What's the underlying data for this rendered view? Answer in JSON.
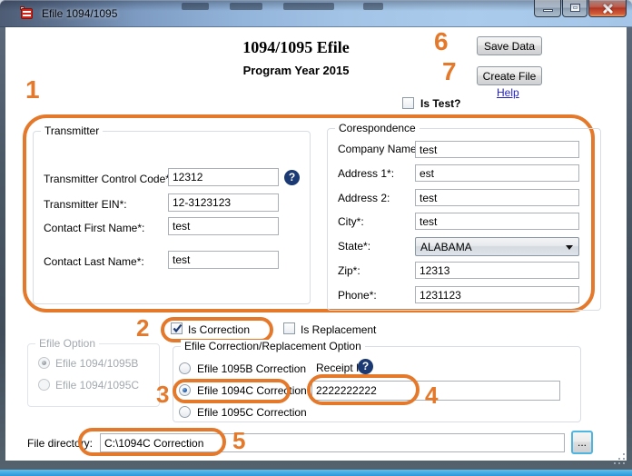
{
  "window": {
    "title": "Efile 1094/1095"
  },
  "header": {
    "title": "1094/1095 Efile",
    "subtitle": "Program Year 2015",
    "save_button": "Save Data",
    "create_button": "Create File",
    "help_link": "Help",
    "is_test_label": "Is Test?"
  },
  "transmitter": {
    "group_label": "Transmitter",
    "fields": [
      {
        "label": "Transmitter Control Code*:",
        "value": "12312"
      },
      {
        "label": "Transmitter EIN*:",
        "value": "12-3123123"
      },
      {
        "label": "Contact First Name*:",
        "value": "test"
      },
      {
        "label": "Contact Last Name*:",
        "value": "test"
      }
    ]
  },
  "correspondence": {
    "group_label": "Corespondence",
    "fields": [
      {
        "label": "Company Name*:",
        "value": "test"
      },
      {
        "label": "Address 1*:",
        "value": "est"
      },
      {
        "label": "Address 2:",
        "value": "test"
      },
      {
        "label": "City*:",
        "value": "test"
      },
      {
        "label": "State*:",
        "value": "ALABAMA"
      },
      {
        "label": "Zip*:",
        "value": "12313"
      },
      {
        "label": "Phone*:",
        "value": "1231123"
      }
    ]
  },
  "options": {
    "is_correction": {
      "label": "Is Correction",
      "checked": true
    },
    "is_replacement": {
      "label": "Is Replacement",
      "checked": false
    },
    "efile_option": {
      "group_label": "Efile Option",
      "disabled": true,
      "items": [
        {
          "label": "Efile 1094/1095B",
          "selected": true
        },
        {
          "label": "Efile 1094/1095C",
          "selected": false
        }
      ]
    },
    "correction_option": {
      "group_label": "Efile Correction/Replacement Option",
      "items": [
        {
          "label": "Efile 1095B Correction",
          "selected": false
        },
        {
          "label": "Efile 1094C Correction",
          "selected": true
        },
        {
          "label": "Efile 1095C Correction",
          "selected": false
        }
      ],
      "receipt_id_label": "Receipt ID",
      "receipt_id_value": "2222222222"
    }
  },
  "file_directory": {
    "label": "File directory:",
    "value": "C:\\1094C Correction",
    "browse_button": "..."
  },
  "icons": {
    "help_glyph": "?"
  },
  "annotations": {
    "color": "#E4792B",
    "labels": {
      "n1": "1",
      "n2": "2",
      "n3": "3",
      "n4": "4",
      "n5": "5",
      "n6": "6",
      "n7": "7"
    }
  }
}
